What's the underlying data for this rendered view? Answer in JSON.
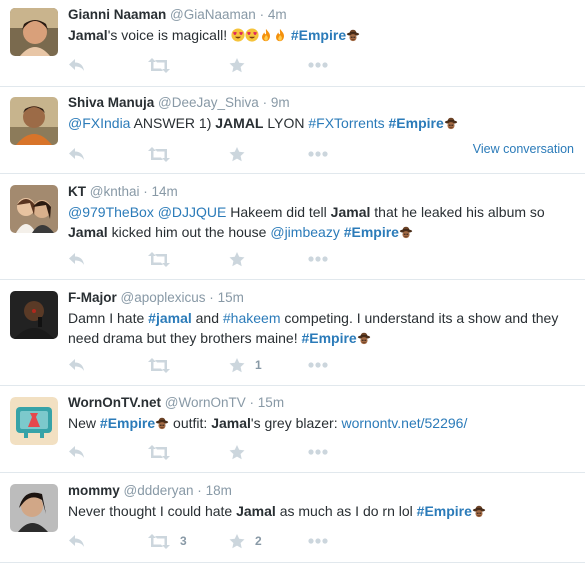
{
  "tweets": [
    {
      "fullname": "Gianni Naaman",
      "screenname": "@GiaNaaman",
      "time": "4m",
      "segments": [
        {
          "kind": "kw",
          "text": "Jamal"
        },
        {
          "kind": "t",
          "text": "'s voice is magicall! "
        },
        {
          "kind": "emoji",
          "icon": "heart-eyes-emoji"
        },
        {
          "kind": "emoji",
          "icon": "heart-eyes-emoji"
        },
        {
          "kind": "emoji",
          "icon": "fire-emoji"
        },
        {
          "kind": "emoji",
          "icon": "fire-emoji"
        },
        {
          "kind": "t",
          "text": " "
        },
        {
          "kind": "hashtag",
          "text": "#Empire"
        },
        {
          "kind": "emoji",
          "icon": "empire-hat-icon"
        }
      ],
      "retweets": "",
      "favorites": "",
      "view_conversation": ""
    },
    {
      "fullname": "Shiva Manuja",
      "screenname": "@DeeJay_Shiva",
      "time": "9m",
      "segments": [
        {
          "kind": "mention",
          "text": "@FXIndia"
        },
        {
          "kind": "t",
          "text": " ANSWER 1) "
        },
        {
          "kind": "kw",
          "text": "JAMAL"
        },
        {
          "kind": "t",
          "text": " LYON "
        },
        {
          "kind": "mention",
          "text": "#FXTorrents"
        },
        {
          "kind": "t",
          "text": " "
        },
        {
          "kind": "hashtag",
          "text": "#Empire"
        },
        {
          "kind": "emoji",
          "icon": "empire-hat-icon"
        }
      ],
      "retweets": "",
      "favorites": "",
      "view_conversation": "View conversation"
    },
    {
      "fullname": "KT",
      "screenname": "@knthai",
      "time": "14m",
      "segments": [
        {
          "kind": "mention",
          "text": "@979TheBox"
        },
        {
          "kind": "t",
          "text": " "
        },
        {
          "kind": "mention",
          "text": "@DJJQUE"
        },
        {
          "kind": "t",
          "text": " Hakeem did tell "
        },
        {
          "kind": "kw",
          "text": "Jamal"
        },
        {
          "kind": "t",
          "text": " that he leaked his album so "
        },
        {
          "kind": "kw",
          "text": "Jamal"
        },
        {
          "kind": "t",
          "text": " kicked him out the house "
        },
        {
          "kind": "mention",
          "text": "@jimbeazy"
        },
        {
          "kind": "t",
          "text": " "
        },
        {
          "kind": "hashtag",
          "text": "#Empire"
        },
        {
          "kind": "emoji",
          "icon": "empire-hat-icon"
        }
      ],
      "retweets": "",
      "favorites": "",
      "view_conversation": ""
    },
    {
      "fullname": "F-Major",
      "screenname": "@apoplexicus",
      "time": "15m",
      "segments": [
        {
          "kind": "t",
          "text": "Damn I hate "
        },
        {
          "kind": "hashtag",
          "text": "#jamal"
        },
        {
          "kind": "t",
          "text": " and "
        },
        {
          "kind": "mention",
          "text": "#hakeem"
        },
        {
          "kind": "t",
          "text": " competing. I understand its a show and they need drama but they brothers maine! "
        },
        {
          "kind": "hashtag",
          "text": "#Empire"
        },
        {
          "kind": "emoji",
          "icon": "empire-hat-icon"
        }
      ],
      "retweets": "",
      "favorites": "1",
      "view_conversation": ""
    },
    {
      "fullname": "WornOnTV.net",
      "screenname": "@WornOnTV",
      "time": "15m",
      "segments": [
        {
          "kind": "t",
          "text": "New "
        },
        {
          "kind": "hashtag",
          "text": "#Empire"
        },
        {
          "kind": "emoji",
          "icon": "empire-hat-icon"
        },
        {
          "kind": "t",
          "text": " outfit: "
        },
        {
          "kind": "kw",
          "text": "Jamal"
        },
        {
          "kind": "t",
          "text": "'s grey blazer: "
        },
        {
          "kind": "link",
          "text": "wornontv.net/52296/"
        }
      ],
      "retweets": "",
      "favorites": "",
      "view_conversation": ""
    },
    {
      "fullname": "mommy",
      "screenname": "@ddderyan",
      "time": "18m",
      "segments": [
        {
          "kind": "t",
          "text": "Never thought I could hate "
        },
        {
          "kind": "kw",
          "text": "Jamal"
        },
        {
          "kind": "t",
          "text": " as much as I do rn lol "
        },
        {
          "kind": "hashtag",
          "text": "#Empire"
        },
        {
          "kind": "emoji",
          "icon": "empire-hat-icon"
        }
      ],
      "retweets": "3",
      "favorites": "2",
      "view_conversation": ""
    }
  ],
  "separator": "·",
  "colors": {
    "link": "#2b7bb9",
    "muted": "#8899a6",
    "icon": "#ccd6dd",
    "divider": "#e1e8ed"
  }
}
